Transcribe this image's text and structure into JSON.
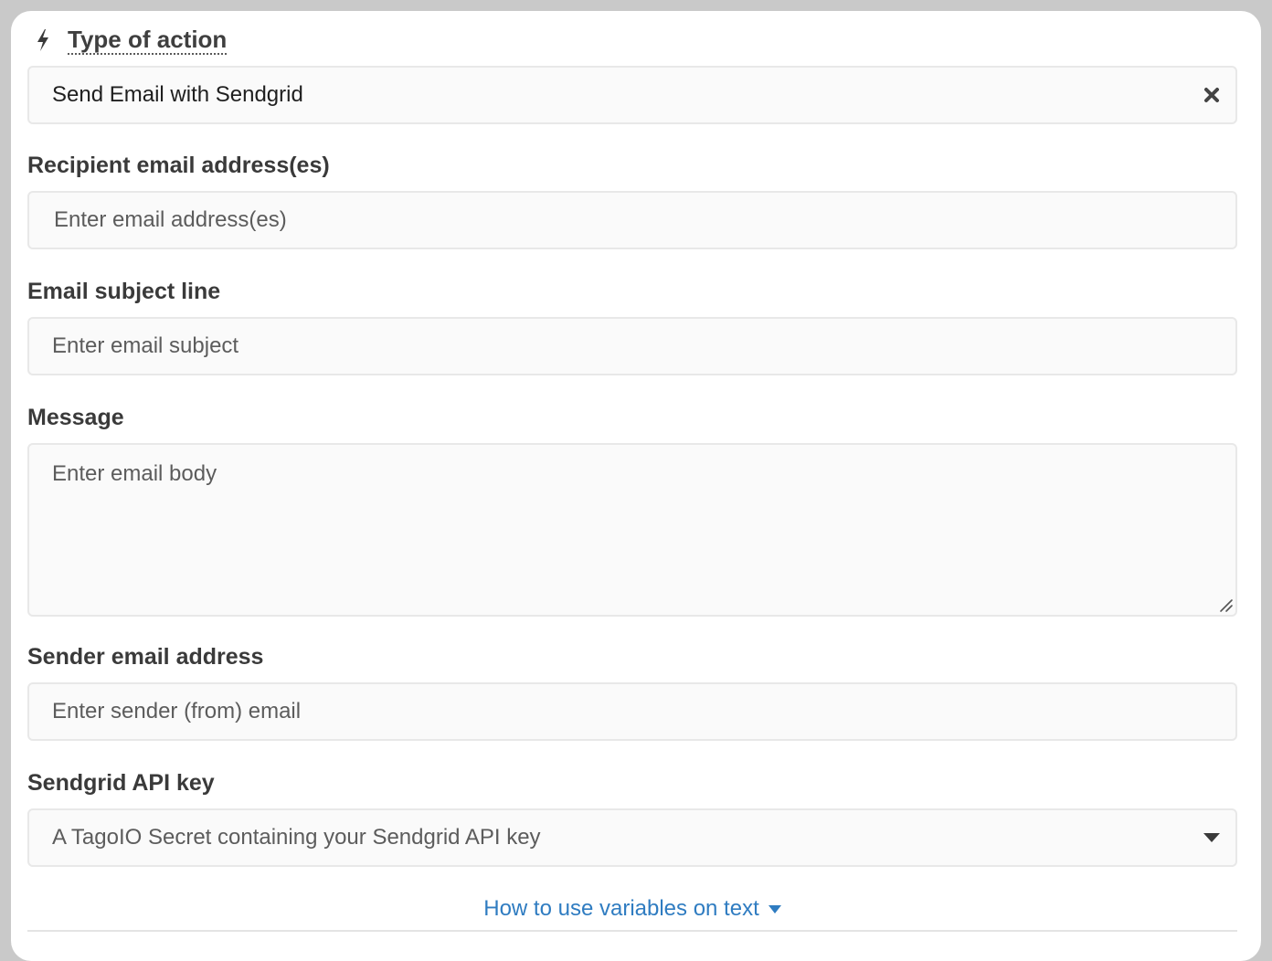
{
  "action_type": {
    "title": "Type of action",
    "icon": "bolt-icon",
    "selected_value": "Send Email with Sendgrid",
    "clear_icon": "close-icon"
  },
  "recipient": {
    "label": "Recipient email address(es)",
    "placeholder": "Enter email address(es)"
  },
  "subject": {
    "label": "Email subject line",
    "placeholder": "Enter email subject"
  },
  "message": {
    "label": "Message",
    "placeholder": "Enter email body"
  },
  "sender": {
    "label": "Sender email address",
    "placeholder": "Enter sender (from) email"
  },
  "api_key": {
    "label": "Sendgrid API key",
    "placeholder": "A TagoIO Secret containing your Sendgrid API key",
    "icon": "chevron-down-icon"
  },
  "help": {
    "link_text": "How to use variables on text",
    "icon": "caret-down-icon"
  },
  "colors": {
    "link": "#2f7cc1",
    "label": "#3a3a3a",
    "field_bg": "#fafafa",
    "field_border": "#e8e8e8",
    "frame_bg": "#c9c9c9"
  }
}
